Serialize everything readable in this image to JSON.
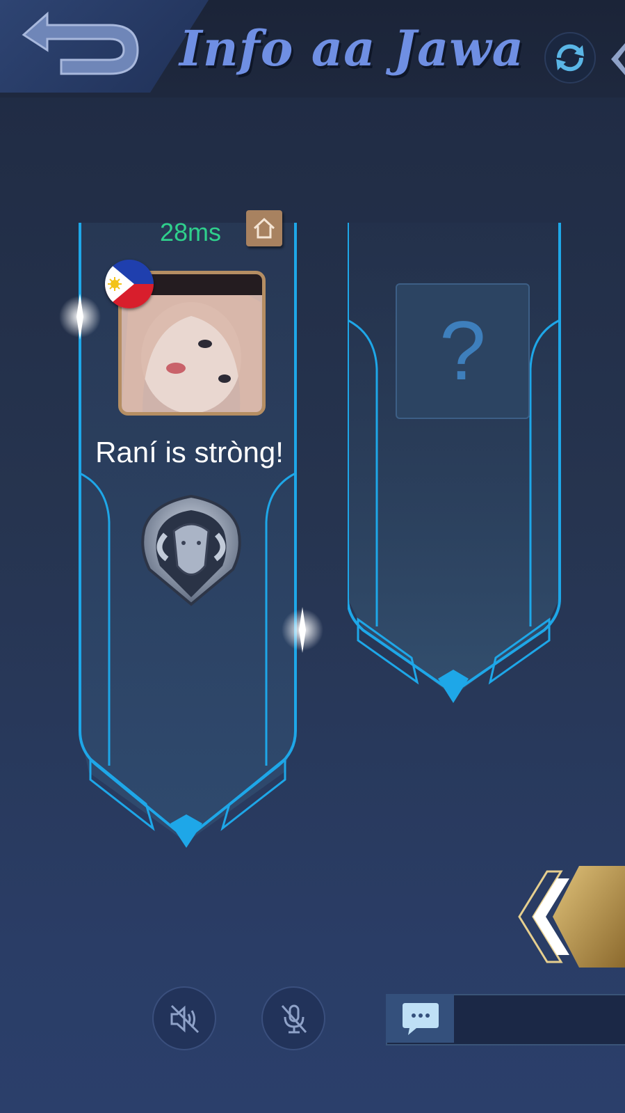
{
  "header": {
    "title": "Info aa Jawa",
    "back_icon": "back-arrow-icon",
    "refresh_icon": "refresh-icon"
  },
  "player_slot": {
    "latency": "28ms",
    "home_icon": "home-icon",
    "flag_icon": "philippines-flag-icon",
    "name": "Raní is stròng!",
    "rank_icon": "ram-rank-emblem-icon"
  },
  "empty_slot": {
    "placeholder": "?"
  },
  "bottom_bar": {
    "speaker_icon": "speaker-muted-icon",
    "mic_icon": "mic-muted-icon",
    "chat_icon": "chat-bubble-icon",
    "chat_input": ""
  },
  "colors": {
    "accent_blue": "#1ea7e8",
    "latency_green": "#2fd08c",
    "gold": "#b58e63",
    "title_blue": "#6f8fe3"
  }
}
